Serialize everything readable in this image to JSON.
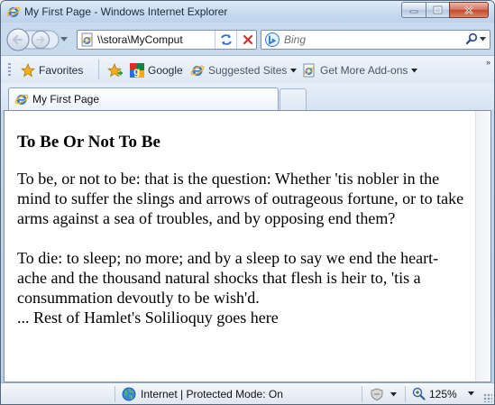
{
  "window": {
    "title": "My First Page - Windows Internet Explorer"
  },
  "navigation": {
    "address": "\\\\stora\\MyComput",
    "search_placeholder": "Bing"
  },
  "favorites_bar": {
    "favorites_label": "Favorites",
    "items": [
      {
        "label": "Google",
        "icon": "google-icon"
      },
      {
        "label": "Suggested Sites",
        "icon": "ie-icon"
      },
      {
        "label": "Get More Add-ons",
        "icon": "ie-icon"
      }
    ]
  },
  "tabs": [
    {
      "label": "My First Page",
      "active": true
    }
  ],
  "document": {
    "heading": "To Be Or Not To Be",
    "paragraph1": "To be, or not to be: that is the question: Whether 'tis nobler in the mind to suffer the slings and arrows of outrageous fortune, or to take arms against a sea of troubles, and by opposing end them?",
    "paragraph2": "To die: to sleep; no more; and by a sleep to say we end the heart-ache and the thousand natural shocks that flesh is heir to, 'tis a consummation devoutly to be wish'd.",
    "paragraph3": "... Rest of Hamlet's Solilioquy goes here"
  },
  "status_bar": {
    "zone": "Internet | Protected Mode: On",
    "zoom": "125%"
  },
  "colors": {
    "chrome": "#c9dcef",
    "close_button": "#c24a30",
    "favorites_star": "#f2b01e"
  }
}
